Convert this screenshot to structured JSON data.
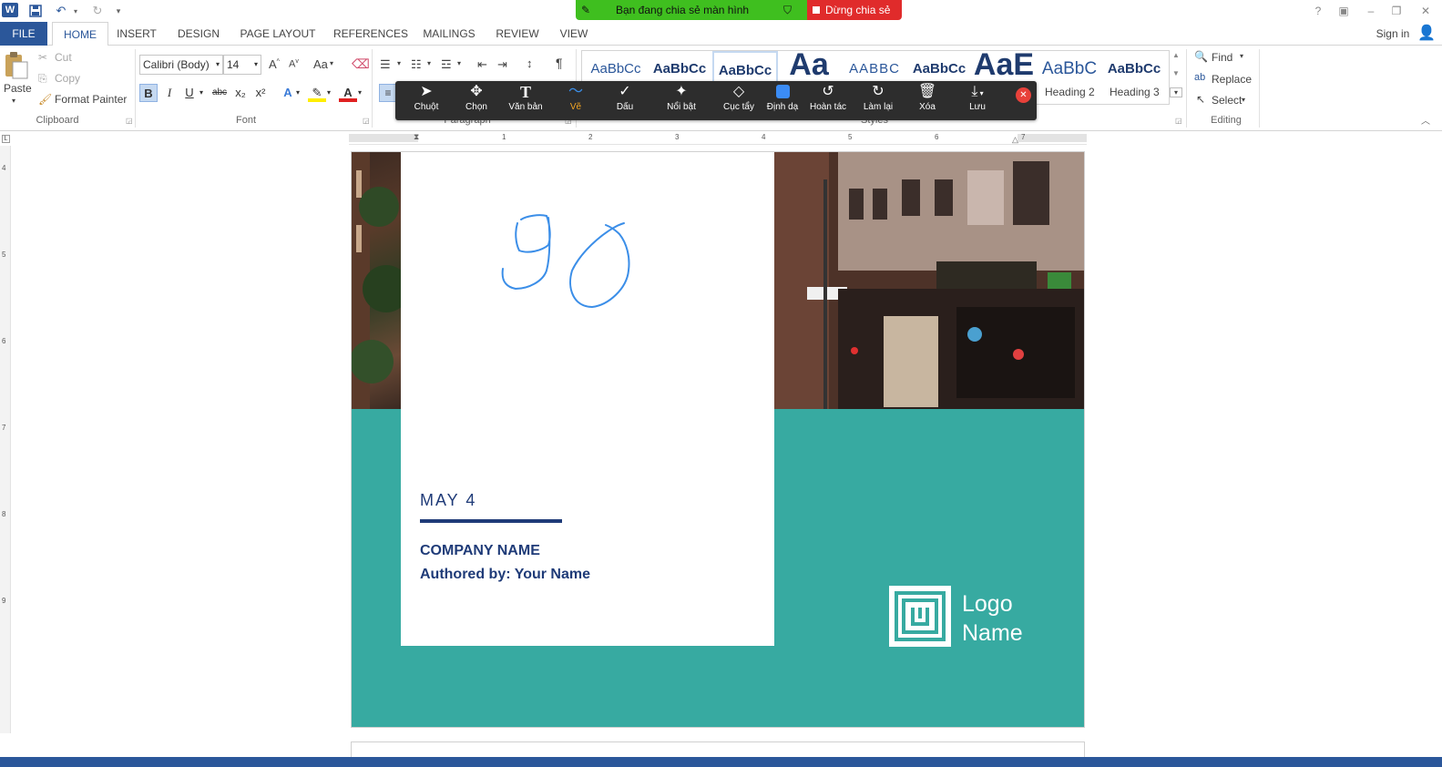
{
  "titlebar": {
    "word_icon": "W",
    "undo_icon": "undo-icon",
    "redo_icon": "redo-icon",
    "help": "?",
    "sign_in": "Sign in"
  },
  "share_banner": {
    "sharing_text": "Bạn đang chia sẻ màn hình",
    "stop_text": "Dừng chia sẻ",
    "colors": {
      "green": "#3fbf1f",
      "red": "#e02b2b"
    }
  },
  "tabs": [
    "FILE",
    "HOME",
    "INSERT",
    "DESIGN",
    "PAGE LAYOUT",
    "REFERENCES",
    "MAILINGS",
    "REVIEW",
    "VIEW"
  ],
  "ribbon": {
    "clipboard": {
      "paste": "Paste",
      "cut": "Cut",
      "copy": "Copy",
      "format_painter": "Format Painter",
      "label": "Clipboard"
    },
    "font": {
      "font_name": "Calibri (Body)",
      "font_size": "14",
      "change_case": "Aa",
      "bold": "B",
      "italic": "I",
      "underline": "U",
      "strike": "abc",
      "subscript": "x₂",
      "superscript": "x²",
      "label": "Font"
    },
    "paragraph": {
      "label": "Paragraph",
      "pilcrow": "¶"
    },
    "styles": {
      "items": [
        "AaBbCc",
        "AaBbCc",
        "AaBbCc",
        "Aa",
        "AABBC",
        "AaBbCc",
        "AaE",
        "AaBbC",
        "AaBbCc"
      ],
      "heading2": "Heading 2",
      "heading3": "Heading 3",
      "label": "Styles"
    },
    "editing": {
      "find": "Find",
      "replace": "Replace",
      "select": "Select",
      "label": "Editing"
    }
  },
  "annotation_toolbar": {
    "tools": [
      {
        "label": "Chuột",
        "icon": "pointer-icon"
      },
      {
        "label": "Chọn",
        "icon": "move-icon"
      },
      {
        "label": "Văn bản",
        "icon": "text-icon"
      },
      {
        "label": "Vẽ",
        "icon": "draw-icon"
      },
      {
        "label": "Dấu",
        "icon": "check-icon"
      },
      {
        "label": "Nổi bật",
        "icon": "spotlight-icon"
      },
      {
        "label": "Cục tẩy",
        "icon": "eraser-icon"
      },
      {
        "label": "Định dạ",
        "icon": "format-icon"
      },
      {
        "label": "Hoàn tác",
        "icon": "undo-icon"
      },
      {
        "label": "Làm lại",
        "icon": "redo-icon"
      },
      {
        "label": "Xóa",
        "icon": "trash-icon"
      },
      {
        "label": "Lưu",
        "icon": "save-icon"
      }
    ],
    "active_color": "#f5a623",
    "swatch_color": "#3b8cf5"
  },
  "ruler": {
    "numbers": [
      "1",
      "2",
      "3",
      "4",
      "5",
      "6",
      "7"
    ],
    "vertical_numbers": [
      "4",
      "5",
      "6",
      "7",
      "8",
      "9"
    ]
  },
  "document": {
    "handwriting_color": "#3b8ee8",
    "date": "MAY 4",
    "company": "COMPANY NAME",
    "author": "Authored by: Your Name",
    "logo_line1": "Logo",
    "logo_line2": "Name",
    "teal_color": "#37aaa1",
    "navy_color": "#1f3b78"
  }
}
